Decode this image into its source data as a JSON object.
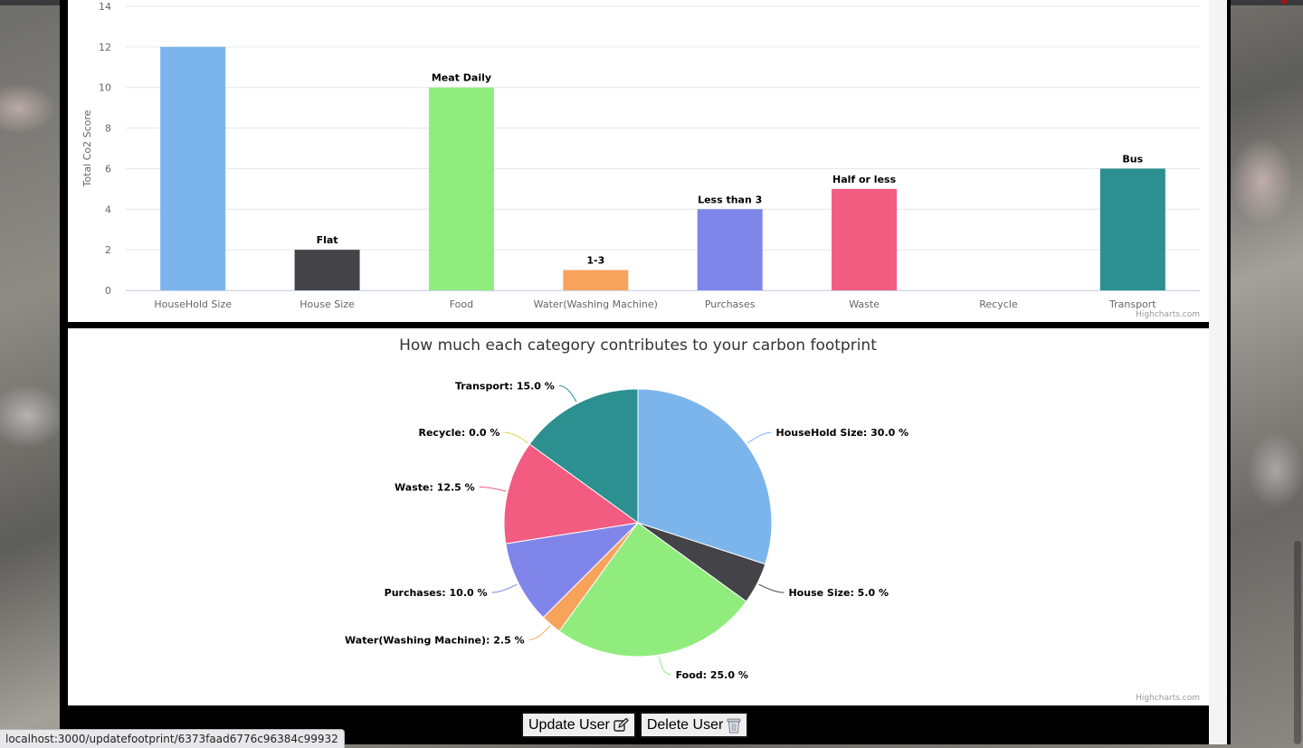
{
  "status_url": "localhost:3000/updatefootprint/6373faad6776c96384c99932",
  "buttons": {
    "update_label": "Update User",
    "delete_label": "Delete User"
  },
  "icons": {
    "update": "edit-icon",
    "delete": "trash-icon"
  },
  "credits": "Highcharts.com",
  "chart_data": [
    {
      "type": "bar",
      "ylabel": "Total Co2 Score",
      "ylim": [
        0,
        14
      ],
      "yticks": [
        0,
        2,
        4,
        6,
        8,
        10,
        12,
        14
      ],
      "grid": true,
      "categories": [
        "HouseHold Size",
        "House Size",
        "Food",
        "Water(Washing Machine)",
        "Purchases",
        "Waste",
        "Recycle",
        "Transport"
      ],
      "values": [
        12,
        2,
        10,
        1,
        4,
        5,
        0,
        6
      ],
      "data_labels": [
        "",
        "Flat",
        "Meat Daily",
        "1-3",
        "Less than 3",
        "Half or less",
        "",
        "Bus"
      ],
      "colors": [
        "#7cb5ec",
        "#434348",
        "#90ed7d",
        "#f7a35c",
        "#8085e9",
        "#f15c80",
        "#e4d354",
        "#2b908f"
      ]
    },
    {
      "type": "pie",
      "title": "How much each category contributes to your carbon footprint",
      "slices": [
        {
          "name": "HouseHold Size",
          "value": 30.0,
          "color": "#7cb5ec"
        },
        {
          "name": "House Size",
          "value": 5.0,
          "color": "#434348"
        },
        {
          "name": "Food",
          "value": 25.0,
          "color": "#90ed7d"
        },
        {
          "name": "Water(Washing Machine)",
          "value": 2.5,
          "color": "#f7a35c"
        },
        {
          "name": "Purchases",
          "value": 10.0,
          "color": "#8085e9"
        },
        {
          "name": "Waste",
          "value": 12.5,
          "color": "#f15c80"
        },
        {
          "name": "Recycle",
          "value": 0.0,
          "color": "#e4d354"
        },
        {
          "name": "Transport",
          "value": 15.0,
          "color": "#2b908f"
        }
      ]
    }
  ]
}
